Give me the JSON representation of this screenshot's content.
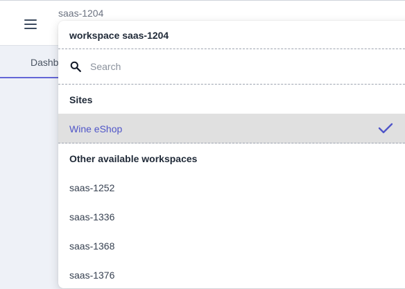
{
  "app": {
    "current_workspace": "saas-1204",
    "tabs": [
      {
        "label": "Dashboard"
      }
    ]
  },
  "dropdown": {
    "header": "workspace saas-1204",
    "search": {
      "placeholder": "Search",
      "value": ""
    },
    "sites_title": "Sites",
    "sites": [
      {
        "label": "Wine eShop",
        "selected": true
      }
    ],
    "other_title": "Other available workspaces",
    "workspaces": [
      {
        "label": "saas-1252"
      },
      {
        "label": "saas-1336"
      },
      {
        "label": "saas-1368"
      },
      {
        "label": "saas-1376"
      }
    ]
  },
  "icons": {
    "menu": "hamburger-menu-icon",
    "search": "search-icon",
    "check": "check-icon"
  },
  "colors": {
    "accent": "#4f55c8",
    "tab_indicator": "#6366d6",
    "selected_row_bg": "#e0e0e0",
    "page_bg": "#eef1f7"
  }
}
